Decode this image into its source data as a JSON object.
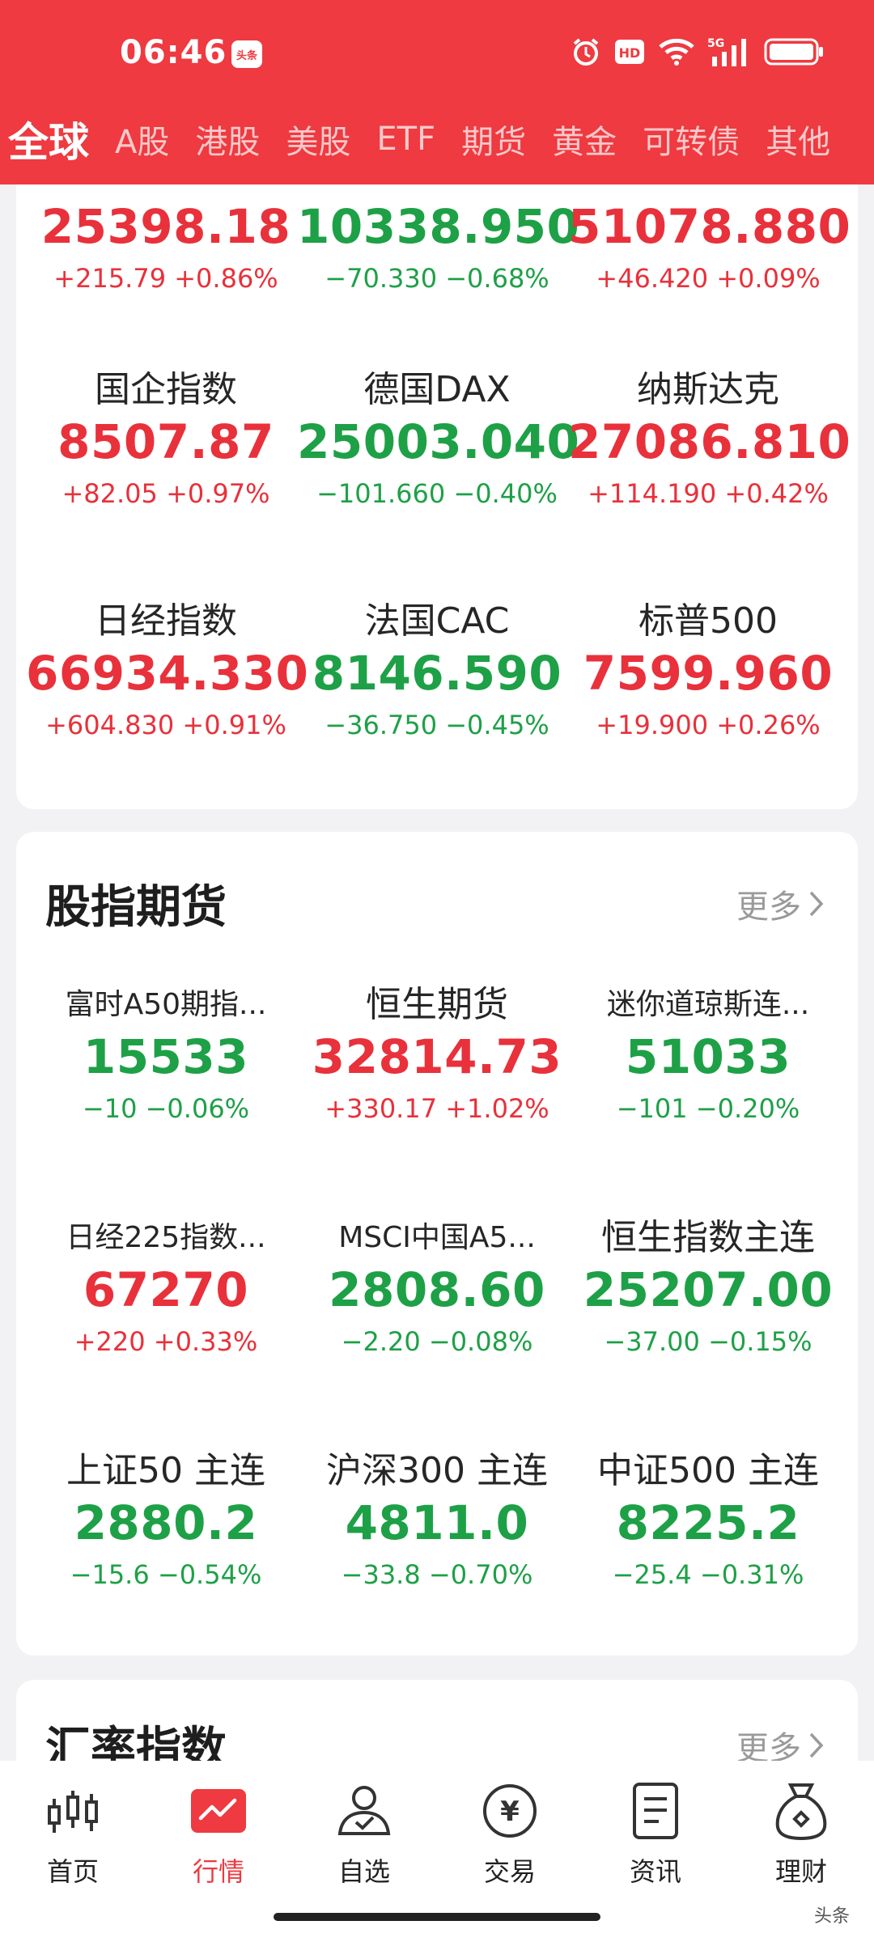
{
  "status_bar": {
    "time": "06:46",
    "app_badge": "头条",
    "network": "5G"
  },
  "tabs": [
    "全球",
    "A股",
    "港股",
    "美股",
    "ETF",
    "期货",
    "黄金",
    "可转债",
    "其他"
  ],
  "top_grid": [
    {
      "name": "",
      "price": "25398.18",
      "change": "+215.79 +0.86%",
      "dir": "up"
    },
    {
      "name": "",
      "price": "10338.950",
      "change": "−70.330 −0.68%",
      "dir": "down"
    },
    {
      "name": "",
      "price": "51078.880",
      "change": "+46.420 +0.09%",
      "dir": "up"
    },
    {
      "name": "国企指数",
      "price": "8507.87",
      "change": "+82.05 +0.97%",
      "dir": "up"
    },
    {
      "name": "德国DAX",
      "price": "25003.040",
      "change": "−101.660 −0.40%",
      "dir": "down"
    },
    {
      "name": "纳斯达克",
      "price": "27086.810",
      "change": "+114.190 +0.42%",
      "dir": "up"
    },
    {
      "name": "日经指数",
      "price": "66934.330",
      "change": "+604.830 +0.91%",
      "dir": "up"
    },
    {
      "name": "法国CAC",
      "price": "8146.590",
      "change": "−36.750 −0.45%",
      "dir": "down"
    },
    {
      "name": "标普500",
      "price": "7599.960",
      "change": "+19.900 +0.26%",
      "dir": "up"
    }
  ],
  "futures": {
    "title": "股指期货",
    "more": "更多",
    "items": [
      {
        "name": "富时A50期指...",
        "price": "15533",
        "change": "−10 −0.06%",
        "dir": "down"
      },
      {
        "name": "恒生期货",
        "price": "32814.73",
        "change": "+330.17 +1.02%",
        "dir": "up"
      },
      {
        "name": "迷你道琼斯连...",
        "price": "51033",
        "change": "−101 −0.20%",
        "dir": "down"
      },
      {
        "name": "日经225指数...",
        "price": "67270",
        "change": "+220 +0.33%",
        "dir": "up"
      },
      {
        "name": "MSCI中国A5...",
        "price": "2808.60",
        "change": "−2.20 −0.08%",
        "dir": "down"
      },
      {
        "name": "恒生指数主连",
        "price": "25207.00",
        "change": "−37.00 −0.15%",
        "dir": "down"
      },
      {
        "name": "上证50 主连",
        "price": "2880.2",
        "change": "−15.6 −0.54%",
        "dir": "down"
      },
      {
        "name": "沪深300 主连",
        "price": "4811.0",
        "change": "−33.8 −0.70%",
        "dir": "down"
      },
      {
        "name": "中证500 主连",
        "price": "8225.2",
        "change": "−25.4 −0.31%",
        "dir": "down"
      }
    ]
  },
  "fx": {
    "title": "汇率指数",
    "more": "更多"
  },
  "bottom_nav": [
    {
      "label": "首页",
      "icon": "candlestick-icon"
    },
    {
      "label": "行情",
      "icon": "market-chart-icon",
      "active": true
    },
    {
      "label": "自选",
      "icon": "user-check-icon"
    },
    {
      "label": "交易",
      "icon": "yuan-coin-icon"
    },
    {
      "label": "资讯",
      "icon": "news-doc-icon"
    },
    {
      "label": "理财",
      "icon": "money-bag-icon"
    }
  ],
  "colors": {
    "header": "#ee3a40",
    "up": "#e8313b",
    "down": "#1ea047"
  },
  "watermark": "头条"
}
